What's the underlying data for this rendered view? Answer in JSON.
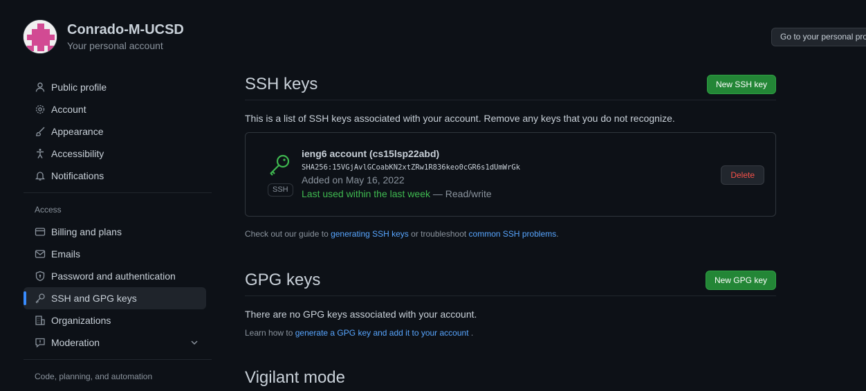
{
  "account": {
    "name": "Conrado-M-UCSD",
    "subtitle": "Your personal account",
    "goto_button": "Go to your personal profile"
  },
  "sidebar": {
    "items_top": [
      {
        "label": "Public profile",
        "icon": "person-icon"
      },
      {
        "label": "Account",
        "icon": "gear-icon"
      },
      {
        "label": "Appearance",
        "icon": "paintbrush-icon"
      },
      {
        "label": "Accessibility",
        "icon": "accessibility-icon"
      },
      {
        "label": "Notifications",
        "icon": "bell-icon"
      }
    ],
    "access_heading": "Access",
    "items_access": [
      {
        "label": "Billing and plans",
        "icon": "credit-card-icon"
      },
      {
        "label": "Emails",
        "icon": "mail-icon"
      },
      {
        "label": "Password and authentication",
        "icon": "shield-lock-icon"
      },
      {
        "label": "SSH and GPG keys",
        "icon": "key-icon",
        "active": true
      },
      {
        "label": "Organizations",
        "icon": "organization-icon"
      },
      {
        "label": "Moderation",
        "icon": "report-icon"
      }
    ],
    "code_heading": "Code, planning, and automation"
  },
  "ssh": {
    "title": "SSH keys",
    "new_button": "New SSH key",
    "description": "This is a list of SSH keys associated with your account. Remove any keys that you do not recognize.",
    "key": {
      "badge": "SSH",
      "name": "ieng6 account (cs15lsp22abd)",
      "fingerprint": "SHA256:15VGjAvlGCoabKN2xtZRw1R836keo0cGR6s1dUmWrGk",
      "added": "Added on May 16, 2022",
      "last_used": "Last used within the last week",
      "access": " — Read/write",
      "delete_button": "Delete"
    },
    "note_prefix": "Check out our guide to ",
    "note_link1": "generating SSH keys",
    "note_middle": " or troubleshoot ",
    "note_link2": "common SSH problems",
    "note_suffix": "."
  },
  "gpg": {
    "title": "GPG keys",
    "new_button": "New GPG key",
    "description": "There are no GPG keys associated with your account.",
    "note_prefix": "Learn how to ",
    "note_link": "generate a GPG key and add it to your account",
    "note_suffix": " ."
  },
  "vigilant": {
    "title": "Vigilant mode"
  },
  "colors": {
    "background": "#0d1117",
    "accent_green": "#238636",
    "link": "#58a6ff",
    "danger": "#f85149",
    "success_text": "#3fb950"
  }
}
